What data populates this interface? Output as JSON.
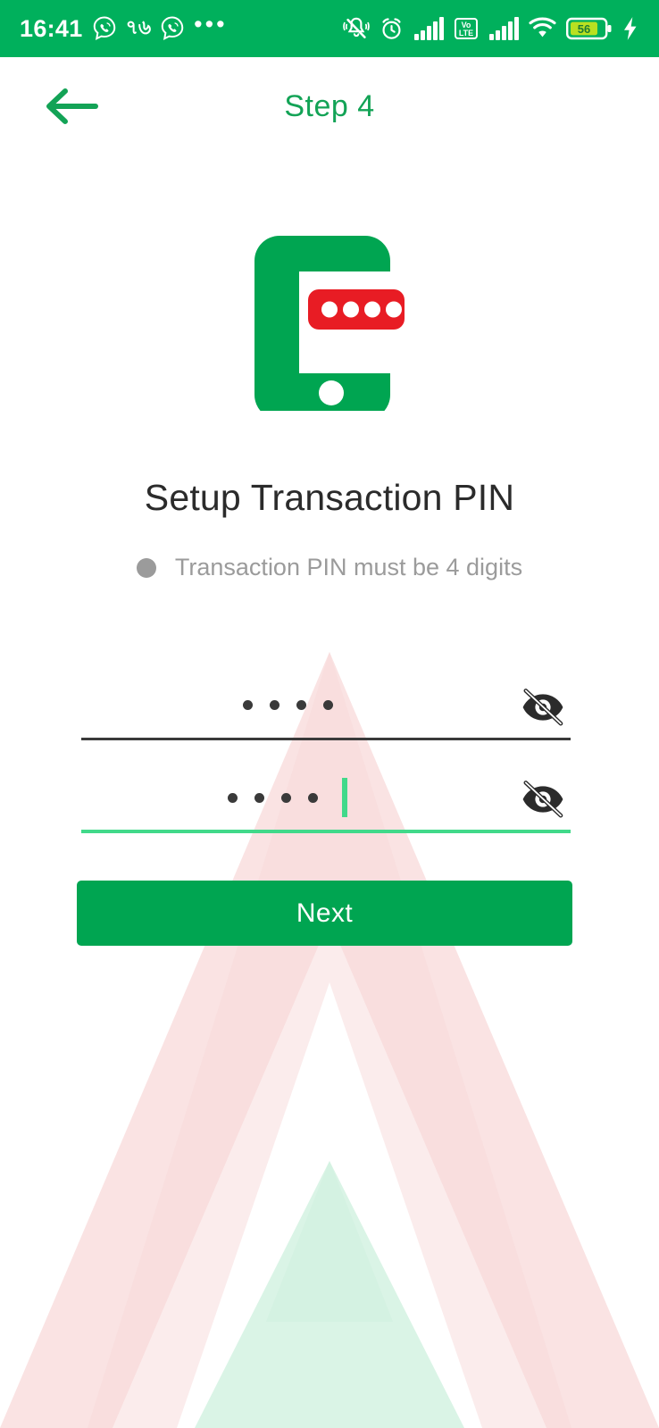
{
  "status_bar": {
    "time": "16:41",
    "bengali_badge": "৭৬",
    "overflow_dots": "•••",
    "battery_level": "56",
    "icons": [
      "viber-call-icon",
      "viber-call-icon-2",
      "more-dots-icon",
      "vibrate-off-icon",
      "alarm-clock-icon",
      "signal-bars-icon",
      "volte-icon",
      "signal-bars-icon-2",
      "wifi-icon",
      "battery-icon",
      "charging-bolt-icon"
    ],
    "volte_label_top": "Vo",
    "volte_label_bottom": "LTE",
    "background_color": "#00b05c"
  },
  "header": {
    "back_label": "back-arrow",
    "title": "Step 4",
    "title_color": "#13a356"
  },
  "illustration": {
    "name": "phone-pin-illustration",
    "phone_color": "#00a551",
    "pin_bar_color": "#e81c24",
    "pin_dot_count": 4
  },
  "content": {
    "title": "Setup Transaction PIN",
    "hint": "Transaction PIN must be 4 digits",
    "hint_color": "#9b9b9b"
  },
  "form": {
    "pin_field": {
      "name": "transaction-pin-input",
      "value": "••••",
      "masked_digits": 4,
      "placeholder": "",
      "focused": false,
      "underline_color": "#3a3a3a",
      "toggle_icon": "eye-off-icon"
    },
    "confirm_pin_field": {
      "name": "confirm-transaction-pin-input",
      "value": "••••",
      "masked_digits": 4,
      "placeholder": "",
      "focused": true,
      "underline_color": "#41d98a",
      "toggle_icon": "eye-off-icon"
    }
  },
  "actions": {
    "next_label": "Next",
    "next_color": "#00a551"
  },
  "watermark": {
    "name": "brand-chevron-watermark",
    "outer_color": "#fbe4e4",
    "inner_color": "#d8f3e4"
  }
}
